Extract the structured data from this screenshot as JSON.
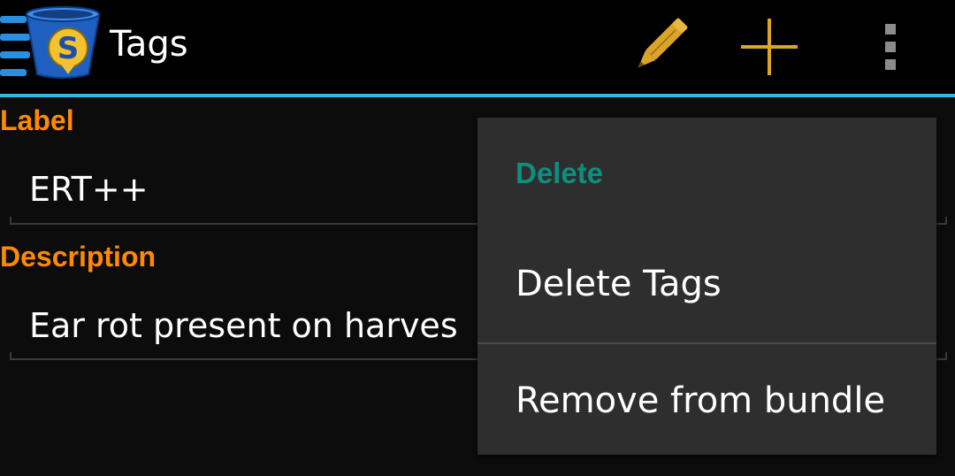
{
  "actionbar": {
    "title": "Tags",
    "icons": {
      "app": "app-logo-icon",
      "edit": "pencil-icon",
      "add": "plus-icon",
      "overflow": "overflow-menu-icon"
    },
    "accent_color": "#33b5e5",
    "action_color": "#dba52a"
  },
  "form": {
    "label_title": "Label",
    "label_value": "ERT++",
    "description_title": "Description",
    "description_value": "Ear rot present on harves",
    "title_color": "#ff8a00"
  },
  "popup_menu": {
    "header": "Delete",
    "header_color": "#0c8f7f",
    "items": [
      {
        "label": "Delete Tags"
      },
      {
        "label": "Remove from bundle"
      }
    ]
  }
}
